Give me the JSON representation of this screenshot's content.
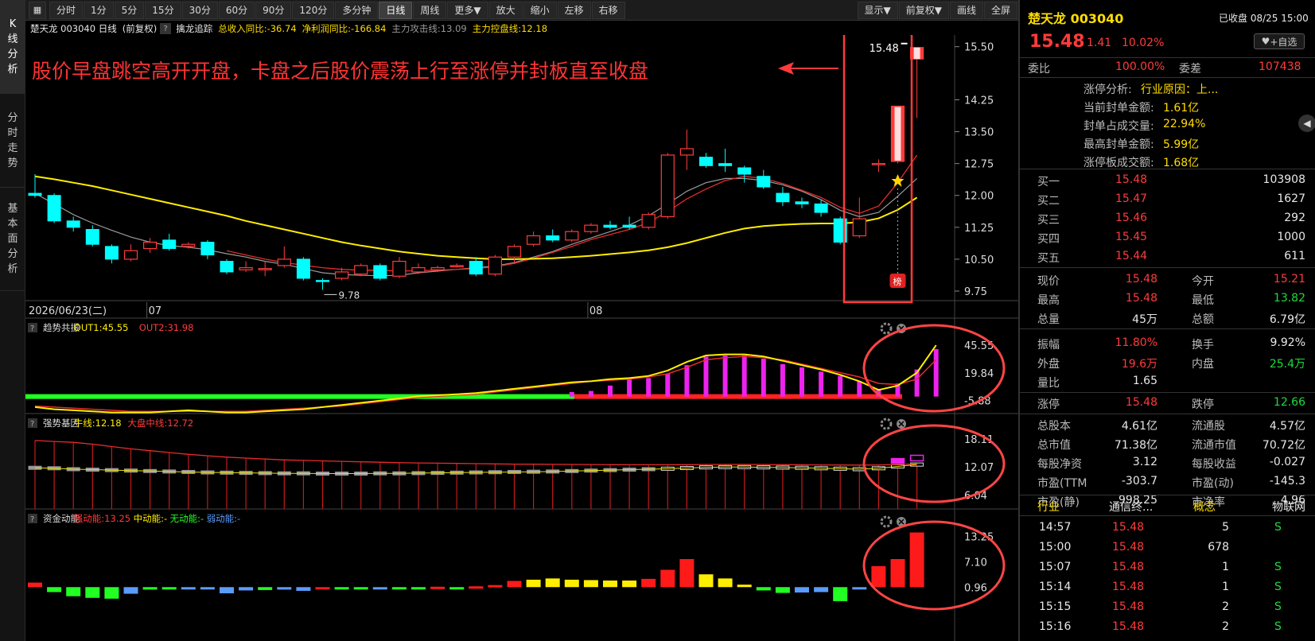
{
  "left_tabs": [
    {
      "label": "K线分析",
      "active": true
    },
    {
      "label": "分时走势",
      "active": false
    },
    {
      "label": "基本面分析",
      "active": false
    }
  ],
  "toolbar": {
    "periods": [
      "分时",
      "1分",
      "5分",
      "15分",
      "30分",
      "60分",
      "90分",
      "120分",
      "多分钟",
      "日线",
      "周线",
      "更多▼"
    ],
    "active_period": "日线",
    "actions": [
      "放大",
      "缩小",
      "左移",
      "右移"
    ],
    "right_buttons": [
      "显示▼",
      "前复权▼",
      "画线",
      "全屏"
    ]
  },
  "info_line": {
    "stock": "楚天龙 003040 日线",
    "adjust": "(前复权)",
    "indicator": "擒龙追踪",
    "rev_yoy": "总收入同比:-36.74",
    "profit_yoy": "净利润同比:-166.84",
    "attack": "主力攻击线:13.09",
    "control": "主力控盘线:12.18"
  },
  "annotation": "股价早盘跳空高开开盘，卡盘之后股价震荡上行至涨停并封板直至收盘",
  "chart_data": [
    {
      "type": "candlestick",
      "y_ticks": [
        "15.50",
        "14.25",
        "13.50",
        "12.75",
        "12.00",
        "11.25",
        "10.50",
        "9.75"
      ],
      "ylim": [
        9.6,
        15.7
      ],
      "x_labels": [
        "2026/06/23(二)",
        "07",
        "08"
      ],
      "x_label_index": [
        0,
        6,
        29
      ],
      "last_price_label": "15.48",
      "low_label": "9.78",
      "low_index": 15,
      "star_label": "榜",
      "candles": [
        {
          "o": 12.05,
          "c": 12.0,
          "h": 12.5,
          "l": 11.95
        },
        {
          "o": 12.0,
          "c": 11.4,
          "h": 12.05,
          "l": 11.35
        },
        {
          "o": 11.4,
          "c": 11.25,
          "h": 11.5,
          "l": 11.15
        },
        {
          "o": 11.2,
          "c": 10.85,
          "h": 11.3,
          "l": 10.8
        },
        {
          "o": 10.8,
          "c": 10.5,
          "h": 10.85,
          "l": 10.4
        },
        {
          "o": 10.5,
          "c": 10.7,
          "h": 10.85,
          "l": 10.45
        },
        {
          "o": 10.75,
          "c": 10.9,
          "h": 11.0,
          "l": 10.65
        },
        {
          "o": 10.95,
          "c": 10.75,
          "h": 11.1,
          "l": 10.7
        },
        {
          "o": 10.8,
          "c": 10.85,
          "h": 10.9,
          "l": 10.75
        },
        {
          "o": 10.9,
          "c": 10.6,
          "h": 10.95,
          "l": 10.5
        },
        {
          "o": 10.45,
          "c": 10.2,
          "h": 10.5,
          "l": 10.15
        },
        {
          "o": 10.25,
          "c": 10.3,
          "h": 10.45,
          "l": 10.2
        },
        {
          "o": 10.25,
          "c": 10.28,
          "h": 10.45,
          "l": 10.1
        },
        {
          "o": 10.35,
          "c": 10.5,
          "h": 10.8,
          "l": 10.3
        },
        {
          "o": 10.5,
          "c": 10.05,
          "h": 10.55,
          "l": 10.0
        },
        {
          "o": 10.0,
          "c": 9.98,
          "h": 10.05,
          "l": 9.78
        },
        {
          "o": 10.05,
          "c": 10.2,
          "h": 10.3,
          "l": 10.0
        },
        {
          "o": 10.15,
          "c": 10.35,
          "h": 10.4,
          "l": 10.1
        },
        {
          "o": 10.35,
          "c": 10.05,
          "h": 10.4,
          "l": 10.0
        },
        {
          "o": 10.1,
          "c": 10.45,
          "h": 10.55,
          "l": 10.05
        },
        {
          "o": 10.2,
          "c": 10.3,
          "h": 10.4,
          "l": 10.15
        },
        {
          "o": 10.25,
          "c": 10.3,
          "h": 10.35,
          "l": 10.2
        },
        {
          "o": 10.35,
          "c": 10.35,
          "h": 10.4,
          "l": 10.3
        },
        {
          "o": 10.45,
          "c": 10.15,
          "h": 10.55,
          "l": 10.1
        },
        {
          "o": 10.15,
          "c": 10.55,
          "h": 10.6,
          "l": 10.1
        },
        {
          "o": 10.55,
          "c": 10.8,
          "h": 10.85,
          "l": 10.4
        },
        {
          "o": 10.85,
          "c": 11.05,
          "h": 11.15,
          "l": 10.8
        },
        {
          "o": 11.05,
          "c": 10.95,
          "h": 11.2,
          "l": 10.9
        },
        {
          "o": 10.95,
          "c": 11.15,
          "h": 11.2,
          "l": 10.9
        },
        {
          "o": 11.15,
          "c": 11.3,
          "h": 11.35,
          "l": 11.1
        },
        {
          "o": 11.3,
          "c": 11.25,
          "h": 11.4,
          "l": 11.2
        },
        {
          "o": 11.3,
          "c": 11.25,
          "h": 11.5,
          "l": 11.2
        },
        {
          "o": 11.25,
          "c": 11.55,
          "h": 11.6,
          "l": 11.2
        },
        {
          "o": 11.5,
          "c": 12.95,
          "h": 13.0,
          "l": 11.45
        },
        {
          "o": 12.95,
          "c": 13.1,
          "h": 13.55,
          "l": 12.6
        },
        {
          "o": 12.9,
          "c": 12.7,
          "h": 13.0,
          "l": 12.65
        },
        {
          "o": 12.75,
          "c": 12.7,
          "h": 13.1,
          "l": 12.55
        },
        {
          "o": 12.65,
          "c": 12.5,
          "h": 12.7,
          "l": 12.3
        },
        {
          "o": 12.45,
          "c": 12.2,
          "h": 12.6,
          "l": 12.15
        },
        {
          "o": 12.05,
          "c": 11.85,
          "h": 12.2,
          "l": 11.75
        },
        {
          "o": 11.85,
          "c": 11.8,
          "h": 11.95,
          "l": 11.7
        },
        {
          "o": 11.8,
          "c": 11.6,
          "h": 11.9,
          "l": 11.5
        },
        {
          "o": 11.45,
          "c": 10.9,
          "h": 11.5,
          "l": 10.85
        },
        {
          "o": 11.05,
          "c": 11.45,
          "h": 11.95,
          "l": 11.0
        },
        {
          "o": 12.75,
          "c": 12.75,
          "h": 12.85,
          "l": 12.55
        },
        {
          "o": 12.8,
          "c": 14.1,
          "h": 14.1,
          "l": 12.75
        },
        {
          "o": 15.21,
          "c": 15.48,
          "h": 15.48,
          "l": 13.82
        }
      ],
      "ma_yellow": [
        12.45,
        12.38,
        12.3,
        12.22,
        12.12,
        12.02,
        11.92,
        11.82,
        11.72,
        11.62,
        11.52,
        11.4,
        11.3,
        11.2,
        11.1,
        11.0,
        10.9,
        10.82,
        10.75,
        10.68,
        10.63,
        10.58,
        10.55,
        10.52,
        10.5,
        10.5,
        10.51,
        10.52,
        10.55,
        10.58,
        10.62,
        10.66,
        10.71,
        10.78,
        10.88,
        11.0,
        11.12,
        11.22,
        11.28,
        11.31,
        11.33,
        11.34,
        11.34,
        11.37,
        11.46,
        11.66,
        11.95
      ],
      "ma_red": [
        null,
        null,
        null,
        null,
        null,
        null,
        null,
        null,
        null,
        null,
        10.7,
        10.6,
        10.5,
        10.42,
        10.36,
        10.3,
        10.26,
        10.24,
        10.24,
        10.22,
        10.23,
        10.24,
        10.26,
        10.28,
        10.32,
        10.4,
        10.52,
        10.66,
        10.8,
        10.96,
        11.08,
        11.2,
        11.36,
        11.62,
        11.92,
        12.15,
        12.35,
        12.45,
        12.4,
        12.28,
        12.12,
        11.95,
        11.72,
        11.58,
        11.75,
        12.3,
        12.95
      ],
      "ma_gray": [
        12.05,
        11.8,
        11.55,
        11.35,
        11.18,
        11.02,
        10.9,
        10.82,
        10.78,
        10.72,
        10.63,
        10.55,
        10.45,
        10.38,
        10.28,
        10.18,
        10.14,
        10.12,
        10.11,
        10.12,
        10.18,
        10.22,
        10.26,
        10.3,
        10.34,
        10.42,
        10.55,
        10.68,
        10.85,
        11.0,
        11.15,
        11.3,
        11.52,
        11.8,
        12.1,
        12.3,
        12.4,
        12.4,
        12.35,
        12.25,
        12.1,
        11.9,
        11.65,
        11.5,
        11.6,
        11.98,
        12.4
      ]
    },
    {
      "type": "bar",
      "name": "趋势共振",
      "out1_label": "OUT1:45.55",
      "out2_label": "OUT2:31.98",
      "y_ticks": [
        "45.55",
        "19.84",
        "-5.88"
      ],
      "ylim": [
        -18,
        53
      ],
      "bars": [
        null,
        null,
        null,
        null,
        null,
        null,
        null,
        null,
        null,
        null,
        null,
        null,
        null,
        null,
        null,
        null,
        null,
        null,
        null,
        null,
        null,
        null,
        null,
        null,
        null,
        null,
        null,
        null,
        2,
        3,
        8,
        14,
        15,
        19,
        27,
        35,
        36,
        36,
        33,
        28,
        25,
        21,
        17,
        12,
        5,
        10,
        23,
        42
      ],
      "out1": [
        -12,
        -14,
        -15,
        -16,
        -17,
        -17,
        -17,
        -16,
        -15,
        -16,
        -17,
        -17,
        -16,
        -15,
        -14,
        -12,
        -10,
        -8,
        -6,
        -4,
        -2,
        -1,
        0,
        1,
        3,
        5,
        7,
        9,
        11,
        12,
        14,
        15,
        17,
        22,
        30,
        36,
        37,
        37,
        35,
        31,
        27,
        23,
        18,
        12,
        4,
        8,
        20,
        45.55
      ],
      "out2": [
        -11,
        -12,
        -13,
        -14,
        -15,
        -16,
        -16,
        -16,
        -16,
        -16,
        -16,
        -16,
        -15,
        -14,
        -13,
        -12,
        -11,
        -9,
        -7,
        -5,
        -3,
        -2,
        -1,
        0,
        2,
        4,
        6,
        8,
        10,
        12,
        13,
        14,
        16,
        19,
        25,
        32,
        34,
        35,
        34,
        32,
        28,
        24,
        20,
        16,
        10,
        9,
        14,
        31.98
      ]
    },
    {
      "type": "bar",
      "name": "强势基因",
      "bull_label": "牛线:12.18",
      "market_label": "大盘中线:12.72",
      "y_ticks": [
        "18.11",
        "12.07",
        "6.04"
      ],
      "ylim": [
        3,
        19.5
      ],
      "bull": [
        11.9,
        11.8,
        11.6,
        11.5,
        11.4,
        11.3,
        11.2,
        11.1,
        11.0,
        10.9,
        10.85,
        10.8,
        10.75,
        10.7,
        10.7,
        10.65,
        10.65,
        10.65,
        10.7,
        10.7,
        10.75,
        10.8,
        10.85,
        10.9,
        10.95,
        11.0,
        11.05,
        11.1,
        11.2,
        11.3,
        11.4,
        11.5,
        11.6,
        11.7,
        11.85,
        12.0,
        12.05,
        12.05,
        12.0,
        11.95,
        11.9,
        11.8,
        11.7,
        11.6,
        11.8,
        12.2,
        12.6
      ],
      "market": [
        17.8,
        17.6,
        17.4,
        17.0,
        16.5,
        16.0,
        15.6,
        15.2,
        14.8,
        14.5,
        14.2,
        14.0,
        13.8,
        13.6,
        13.5,
        13.4,
        13.3,
        13.2,
        13.1,
        13.0,
        12.95,
        12.9,
        12.85,
        12.8,
        12.75,
        12.7,
        12.68,
        12.65,
        12.62,
        12.6,
        12.58,
        12.56,
        12.55,
        12.55,
        12.57,
        12.6,
        12.62,
        12.62,
        12.6,
        12.58,
        12.55,
        12.52,
        12.5,
        12.48,
        12.52,
        12.62,
        12.72
      ],
      "ribbon_top": [
        12.45,
        12.38,
        12.3,
        12.22,
        12.12,
        12.02,
        11.92,
        11.82,
        11.72,
        11.62,
        11.52,
        11.4,
        11.3,
        11.2,
        11.1,
        11.0,
        10.9,
        10.82,
        10.75,
        10.68,
        10.63,
        10.58,
        10.55,
        10.52,
        10.5,
        10.5,
        10.51,
        10.52,
        10.55,
        10.58,
        10.62,
        10.66,
        10.71,
        10.78,
        10.88,
        11.0,
        11.12,
        11.22,
        11.28,
        11.31,
        11.33,
        11.34,
        11.34,
        11.37,
        11.46,
        11.66,
        11.95
      ]
    },
    {
      "type": "bar",
      "name": "资金动能",
      "strong_label": "强动能:13.25",
      "mid_label": "中动能:-",
      "none_label": "无动能:-",
      "weak_label": "弱动能:-",
      "y_ticks": [
        "13.25",
        "7.10",
        "0.96"
      ],
      "ylim": [
        -4,
        14.5
      ],
      "values": [
        1.1,
        -1.2,
        -2.2,
        -2.6,
        -2.8,
        -1.6,
        -0.6,
        -0.5,
        -0.3,
        -0.4,
        -1.5,
        -0.8,
        -0.7,
        -0.6,
        -0.9,
        -0.4,
        -0.2,
        -0.3,
        -0.4,
        -0.2,
        -0.1,
        0.1,
        -0.1,
        0.2,
        0.5,
        1.5,
        1.8,
        2.1,
        1.8,
        1.7,
        1.6,
        1.6,
        2.0,
        4.2,
        6.8,
        3.1,
        2.1,
        0.6,
        -0.8,
        -1.4,
        -1.3,
        -1.2,
        -3.4,
        -0.5,
        5.1,
        6.8,
        13.25
      ],
      "colors": [
        "red",
        "green",
        "green",
        "green",
        "green",
        "blue",
        "green",
        "green",
        "blue",
        "blue",
        "blue",
        "blue",
        "green",
        "blue",
        "blue",
        "red",
        "green",
        "green",
        "blue",
        "green",
        "green",
        "red",
        "green",
        "red",
        "red",
        "red",
        "yellow",
        "yellow",
        "yellow",
        "yellow",
        "yellow",
        "yellow",
        "red",
        "red",
        "red",
        "yellow",
        "yellow",
        "yellow",
        "green",
        "green",
        "blue",
        "blue",
        "green",
        "blue",
        "red",
        "red",
        "red"
      ]
    }
  ],
  "right_panel": {
    "name": "楚天龙",
    "code": "003040",
    "status": "已收盘 08/25 15:00",
    "price": "15.48",
    "change": "1.41",
    "pct": "10.02%",
    "watch_button": "+自选",
    "weibi_label": "委比",
    "weibi": "100.00%",
    "weicha_label": "委差",
    "weicha": "107438",
    "limit_info": [
      {
        "label": "涨停分析:",
        "value": "行业原因：上..."
      },
      {
        "label": "当前封单金额:",
        "value": "1.61亿"
      },
      {
        "label": "封单占成交量:",
        "value": "22.94%"
      },
      {
        "label": "最高封单金额:",
        "value": "5.99亿"
      },
      {
        "label": "涨停板成交额:",
        "value": "1.68亿"
      }
    ],
    "bids": [
      {
        "label": "买一",
        "price": "15.48",
        "vol": "103908"
      },
      {
        "label": "买二",
        "price": "15.47",
        "vol": "1627"
      },
      {
        "label": "买三",
        "price": "15.46",
        "vol": "292"
      },
      {
        "label": "买四",
        "price": "15.45",
        "vol": "1000"
      },
      {
        "label": "买五",
        "price": "15.44",
        "vol": "611"
      }
    ],
    "stats": [
      [
        {
          "l": "现价",
          "v": "15.48",
          "c": "red"
        },
        {
          "l": "今开",
          "v": "15.21",
          "c": "red"
        }
      ],
      [
        {
          "l": "最高",
          "v": "15.48",
          "c": "red"
        },
        {
          "l": "最低",
          "v": "13.82",
          "c": "green"
        }
      ],
      [
        {
          "l": "总量",
          "v": "45万",
          "c": "white"
        },
        {
          "l": "总额",
          "v": "6.79亿",
          "c": "white"
        }
      ],
      [
        {
          "l": "振幅",
          "v": "11.80%",
          "c": "red"
        },
        {
          "l": "换手",
          "v": "9.92%",
          "c": "white"
        }
      ],
      [
        {
          "l": "外盘",
          "v": "19.6万",
          "c": "red"
        },
        {
          "l": "内盘",
          "v": "25.4万",
          "c": "green"
        }
      ],
      [
        {
          "l": "量比",
          "v": "1.65",
          "c": "white"
        },
        {
          "l": "",
          "v": "",
          "c": "white"
        }
      ],
      [
        {
          "l": "涨停",
          "v": "15.48",
          "c": "red"
        },
        {
          "l": "跌停",
          "v": "12.66",
          "c": "green"
        }
      ],
      [
        {
          "l": "总股本",
          "v": "4.61亿",
          "c": "white"
        },
        {
          "l": "流通股",
          "v": "4.57亿",
          "c": "white"
        }
      ],
      [
        {
          "l": "总市值",
          "v": "71.38亿",
          "c": "white"
        },
        {
          "l": "流通市值",
          "v": "70.72亿",
          "c": "white"
        }
      ],
      [
        {
          "l": "每股净资",
          "v": "3.12",
          "c": "white"
        },
        {
          "l": "每股收益",
          "v": "-0.027",
          "c": "white"
        }
      ],
      [
        {
          "l": "市盈(TTM",
          "v": "-303.7",
          "c": "white"
        },
        {
          "l": "市盈(动)",
          "v": "-145.3",
          "c": "white"
        }
      ],
      [
        {
          "l": "市盈(静)",
          "v": "998.25",
          "c": "white"
        },
        {
          "l": "市净率",
          "v": "4.96",
          "c": "white"
        }
      ]
    ],
    "industry_label": "行业",
    "industry": "通信终...",
    "concept_label": "概念",
    "concept": "物联网",
    "ticks": [
      {
        "t": "14:57",
        "p": "15.48",
        "v": "5",
        "s": "S"
      },
      {
        "t": "15:00",
        "p": "15.48",
        "v": "678",
        "s": ""
      },
      {
        "t": "15:07",
        "p": "15.48",
        "v": "1",
        "s": "S"
      },
      {
        "t": "15:14",
        "p": "15.48",
        "v": "1",
        "s": "S"
      },
      {
        "t": "15:15",
        "p": "15.48",
        "v": "2",
        "s": "S"
      },
      {
        "t": "15:16",
        "p": "15.48",
        "v": "2",
        "s": "S"
      }
    ]
  }
}
